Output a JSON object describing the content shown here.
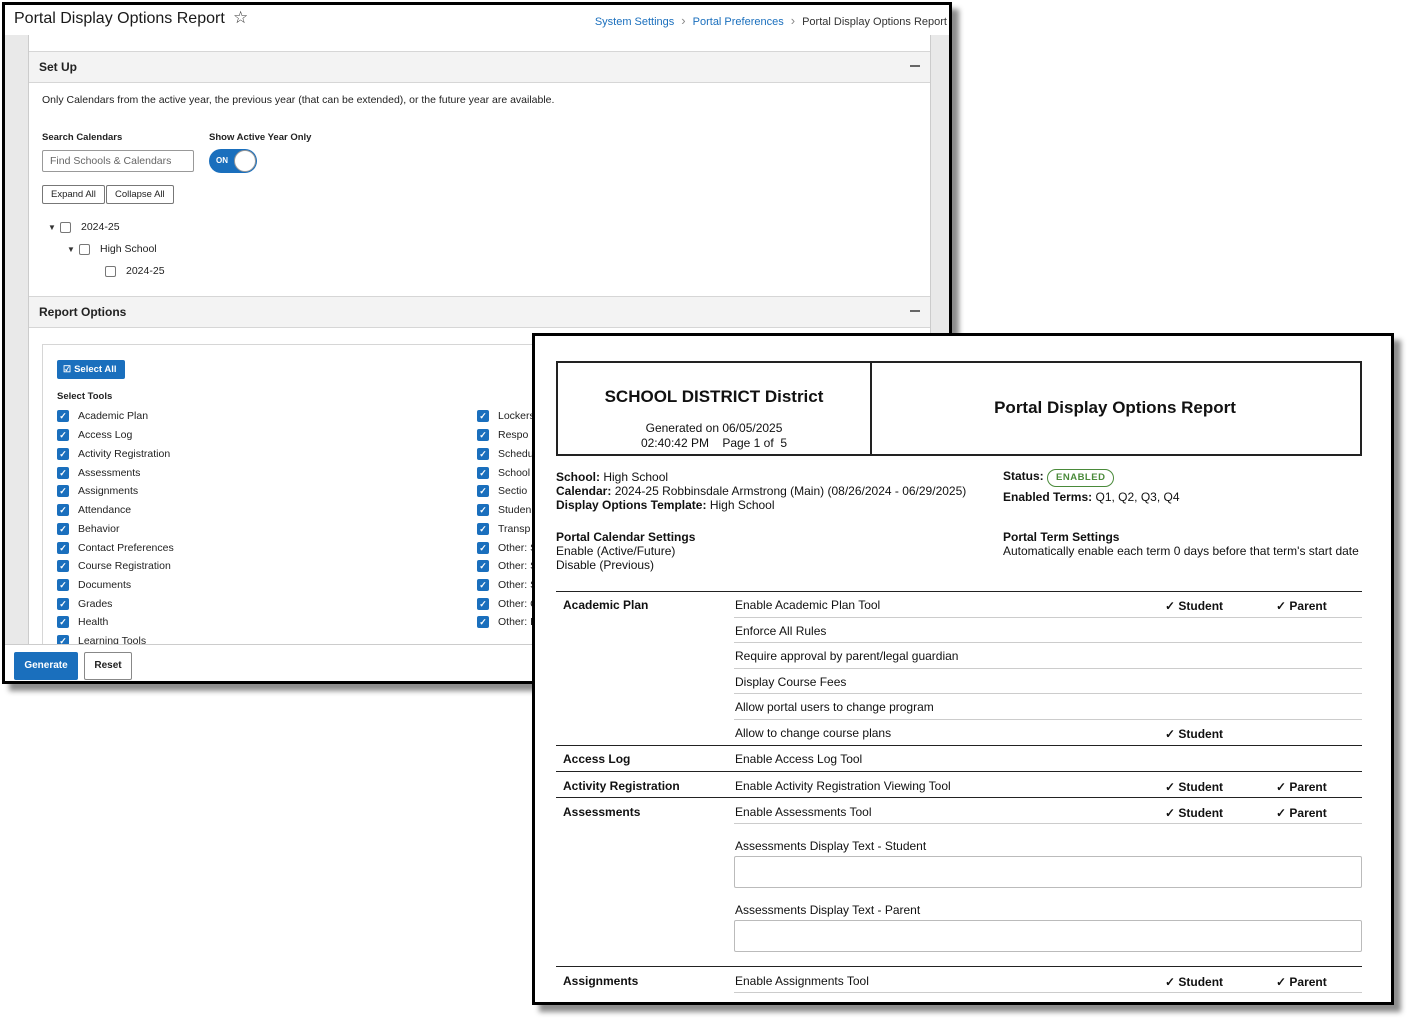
{
  "back_window": {
    "title": "Portal Display Options Report",
    "breadcrumb": [
      "System Settings",
      "Portal Preferences",
      "Portal Display Options Report"
    ],
    "setup": {
      "title": "Set Up",
      "note": "Only Calendars from the active year, the previous year (that can be extended), or the future year are available.",
      "search_label": "Search Calendars",
      "search_placeholder": "Find Schools & Calendars",
      "toggle_label": "Show Active Year Only",
      "toggle_state": "ON",
      "expand_all": "Expand All",
      "collapse_all": "Collapse All",
      "tree": [
        "2024-25",
        "High School",
        "2024-25"
      ]
    },
    "report_options": {
      "title": "Report Options",
      "select_all": "Select All",
      "select_tools_label": "Select Tools",
      "tools_left": [
        "Academic Plan",
        "Access Log",
        "Activity Registration",
        "Assessments",
        "Assignments",
        "Attendance",
        "Behavior",
        "Contact Preferences",
        "Course Registration",
        "Documents",
        "Grades",
        "Health",
        "Learning Tools"
      ],
      "tools_right": [
        "Lockers",
        "Respo",
        "Schedu",
        "School",
        "Sectio",
        "Studen",
        "Transp",
        "Other: S",
        "Other: S",
        "Other: S",
        "Other: C",
        "Other: E"
      ]
    },
    "footer": {
      "generate": "Generate",
      "reset": "Reset"
    }
  },
  "report": {
    "district": "SCHOOL DISTRICT District",
    "generated_line": "Generated on 06/05/2025",
    "time_page_line": "02:40:42 PM    Page 1 of  5",
    "title": "Portal Display Options Report",
    "school_label": "School:",
    "school_value": "High School",
    "calendar_label": "Calendar:",
    "calendar_value": "2024-25 Robbinsdale Armstrong (Main) (08/26/2024 - 06/29/2025)",
    "template_label": "Display Options Template:",
    "template_value": "High School",
    "status_label": "Status:",
    "status_value": "ENABLED",
    "terms_label": "Enabled Terms:",
    "terms_value": "Q1, Q2, Q3, Q4",
    "calendar_settings_title": "Portal Calendar Settings",
    "calendar_settings": [
      "Enable (Active/Future)",
      "Disable (Previous)"
    ],
    "term_settings_title": "Portal Term Settings",
    "term_settings": "Automatically enable each term 0 days before that term's start date",
    "check_student": "✓ Student",
    "check_parent": "✓ Parent",
    "sections": [
      {
        "tool": "Academic Plan",
        "options": [
          "Enable Academic Plan Tool",
          "Enforce All Rules",
          "Require approval by parent/legal guardian",
          "Display Course Fees",
          "Allow portal users to change program",
          "Allow to change course plans"
        ]
      },
      {
        "tool": "Access Log",
        "options": [
          "Enable Access Log Tool"
        ]
      },
      {
        "tool": "Activity Registration",
        "options": [
          "Enable Activity Registration Viewing Tool"
        ]
      },
      {
        "tool": "Assessments",
        "options": [
          "Enable Assessments Tool",
          "Assessments Display Text - Student",
          "Assessments Display Text - Parent"
        ]
      },
      {
        "tool": "Assignments",
        "options": [
          "Enable Assignments Tool"
        ]
      }
    ]
  }
}
